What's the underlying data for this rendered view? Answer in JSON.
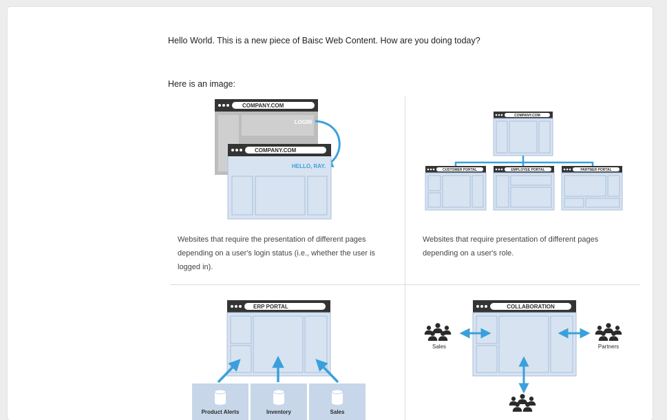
{
  "intro_text": "Hello World. This is a new piece of Baisc Web Content. How are you doing today?",
  "image_label": "Here is an image:",
  "panel1": {
    "back_url": "COMPANY.COM",
    "back_label": "LOGIN",
    "front_url": "COMPANY.COM",
    "front_label": "HELLO, RAY.",
    "caption": "Websites that require the presentation of different pages depending on a user's login status (i.e., whether the user is logged in)."
  },
  "panel2": {
    "top_url": "COMPANY.COM",
    "portals": [
      "CUSTOMER PORTAL",
      "EMPLOYEE PORTAL",
      "PARTNER PORTAL"
    ],
    "caption": "Websites that require presentation of different pages depending on a user's role."
  },
  "panel3": {
    "title": "ERP PORTAL",
    "sources": [
      "Product Alerts",
      "Inventory",
      "Sales"
    ]
  },
  "panel4": {
    "title": "COLLABORATION",
    "left_group": "Sales",
    "right_group": "Partners"
  },
  "colors": {
    "accent_blue": "#3aa0dc",
    "window_fill": "#d7e3f1",
    "window_stroke": "#a9bfdc",
    "titlebar": "#343434",
    "gray_window": "#bdbdbd"
  }
}
